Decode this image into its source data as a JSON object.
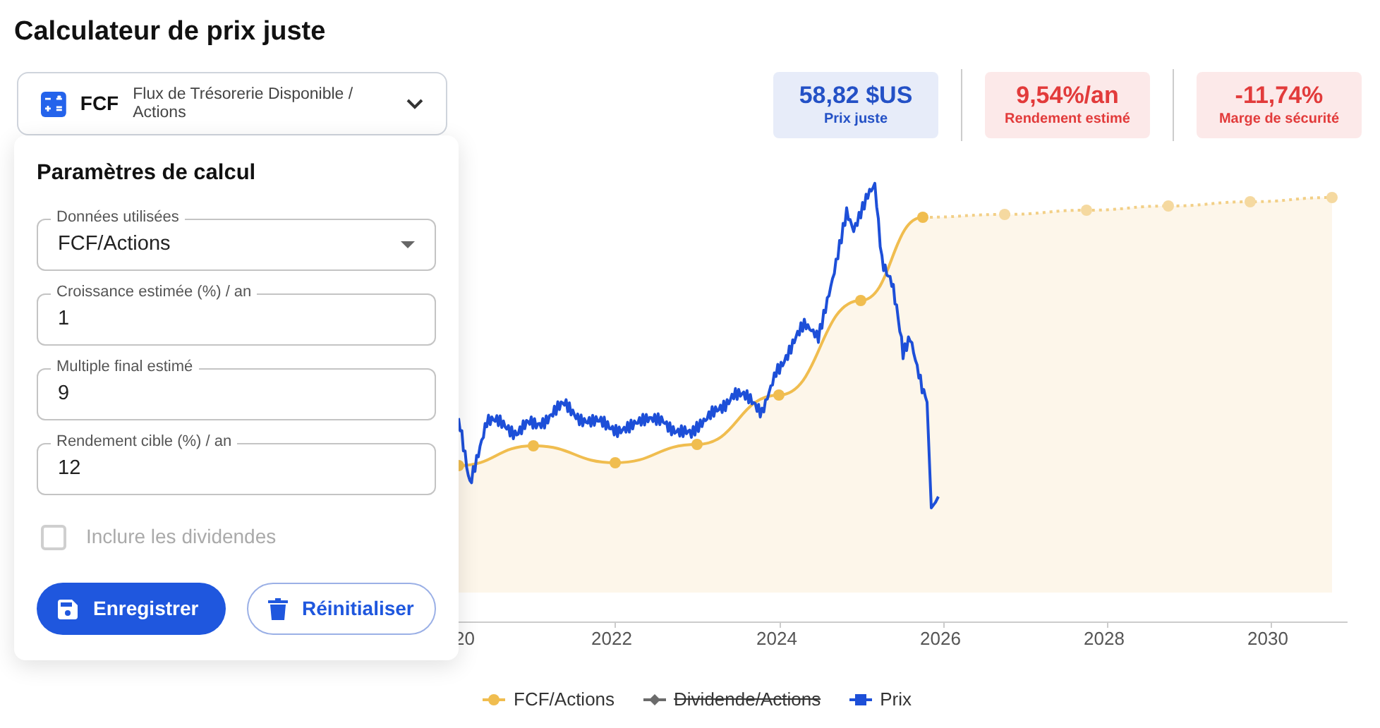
{
  "title": "Calculateur de prix juste",
  "method_dropdown": {
    "badge": "FCF",
    "label": "Flux de Trésorerie Disponible / Actions"
  },
  "metrics": [
    {
      "value": "58,82 $US",
      "label": "Prix juste",
      "color": "#2451c6"
    },
    {
      "value": "9,54%/an",
      "label": "Rendement estimé",
      "color": "#e23b3b"
    },
    {
      "value": "-11,74%",
      "label": "Marge de sécurité",
      "color": "#e23b3b"
    }
  ],
  "panel": {
    "title": "Paramètres de calcul",
    "fields": [
      {
        "kind": "select",
        "label": "Données utilisées",
        "value": "FCF/Actions"
      },
      {
        "kind": "number",
        "label": "Croissance estimée (%) / an",
        "value": "1"
      },
      {
        "kind": "number",
        "label": "Multiple final estimé",
        "value": "9"
      },
      {
        "kind": "number",
        "label": "Rendement cible (%) / an",
        "value": "12"
      }
    ],
    "checkbox": {
      "label": "Inclure les dividendes",
      "checked": false,
      "disabled": true
    },
    "buttons": [
      {
        "kind": "primary",
        "label": "Enregistrer"
      },
      {
        "kind": "outline",
        "label": "Réinitialiser"
      }
    ]
  },
  "chart": {
    "x_labels": [
      "20",
      "2022",
      "2024",
      "2026",
      "2028",
      "2030"
    ],
    "legend": [
      {
        "label": "FCF/Actions",
        "kind": "circle",
        "color": "#f0bd4f",
        "hidden": false
      },
      {
        "label": "Dividende/Actions",
        "kind": "diamond",
        "color": "#6b6b6b",
        "hidden": true
      },
      {
        "label": "Prix",
        "kind": "square",
        "color": "#1d4fd8",
        "hidden": false
      }
    ]
  }
}
